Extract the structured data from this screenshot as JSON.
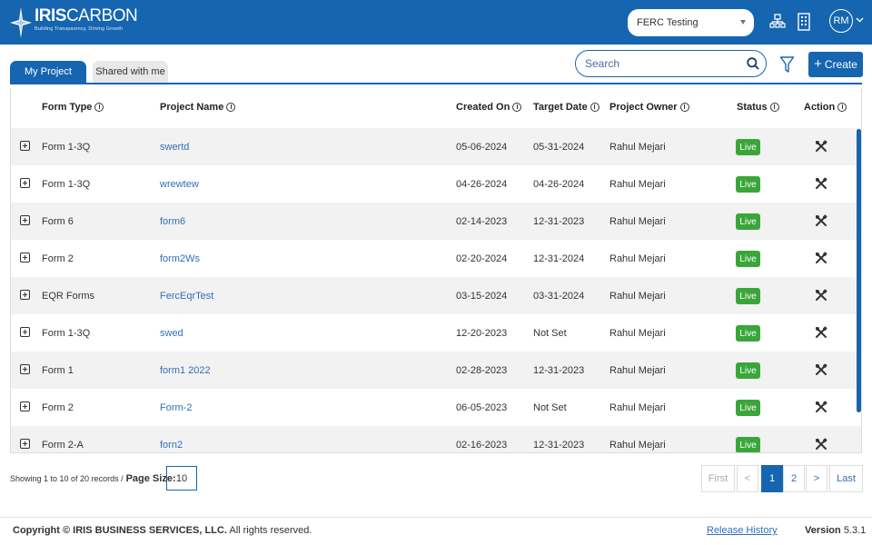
{
  "header": {
    "logo_prefix": "IRIS",
    "logo_suffix": "CARBON",
    "logo_tagline": "Building Transparency, Driving Growth",
    "project_selected": "FERC Testing",
    "avatar_initials": "RM",
    "brand_color": "#1565b0"
  },
  "tabs": [
    {
      "label": "My Project",
      "active": true
    },
    {
      "label": "Shared with me",
      "active": false
    }
  ],
  "toolbar": {
    "search_placeholder": "Search",
    "create_label": "Create"
  },
  "table": {
    "columns": [
      "Form Type",
      "Project Name",
      "Created On",
      "Target Date",
      "Project Owner",
      "Status",
      "Action"
    ],
    "rows": [
      {
        "form_type": "Form 1-3Q",
        "project_name": "swertd",
        "created_on": "05-06-2024",
        "target_date": "05-31-2024",
        "owner": "Rahul Mejari",
        "status": "Live"
      },
      {
        "form_type": "Form 1-3Q",
        "project_name": "wrewtew",
        "created_on": "04-26-2024",
        "target_date": "04-26-2024",
        "owner": "Rahul Mejari",
        "status": "Live"
      },
      {
        "form_type": "Form 6",
        "project_name": "form6",
        "created_on": "02-14-2023",
        "target_date": "12-31-2023",
        "owner": "Rahul Mejari",
        "status": "Live"
      },
      {
        "form_type": "Form 2",
        "project_name": "form2Ws",
        "created_on": "02-20-2024",
        "target_date": "12-31-2024",
        "owner": "Rahul Mejari",
        "status": "Live"
      },
      {
        "form_type": "EQR Forms",
        "project_name": "FercEqrTest",
        "created_on": "03-15-2024",
        "target_date": "03-31-2024",
        "owner": "Rahul Mejari",
        "status": "Live"
      },
      {
        "form_type": "Form 1-3Q",
        "project_name": "swed",
        "created_on": "12-20-2023",
        "target_date": "Not Set",
        "owner": "Rahul Mejari",
        "status": "Live"
      },
      {
        "form_type": "Form 1",
        "project_name": "form1 2022",
        "created_on": "02-28-2023",
        "target_date": "12-31-2023",
        "owner": "Rahul Mejari",
        "status": "Live"
      },
      {
        "form_type": "Form 2",
        "project_name": "Form-2",
        "created_on": "06-05-2023",
        "target_date": "Not Set",
        "owner": "Rahul Mejari",
        "status": "Live"
      },
      {
        "form_type": "Form 2-A",
        "project_name": "forn2",
        "created_on": "02-16-2023",
        "target_date": "12-31-2023",
        "owner": "Rahul Mejari",
        "status": "Live"
      }
    ],
    "status_color": "#3aa63a"
  },
  "pagination": {
    "records_text": "Showing 1 to 10 of 20 records /",
    "page_size_label": "Page Size:",
    "page_size": "10",
    "first": "First",
    "prev": "<",
    "pages": [
      "1",
      "2"
    ],
    "current_page": "1",
    "next": ">",
    "last": "Last"
  },
  "footer": {
    "copyright_prefix": "Copyright ©",
    "company": "IRIS BUSINESS SERVICES, LLC.",
    "rights": "All rights reserved.",
    "release_history": "Release History",
    "version_label": "Version",
    "version": "5.3.1"
  }
}
